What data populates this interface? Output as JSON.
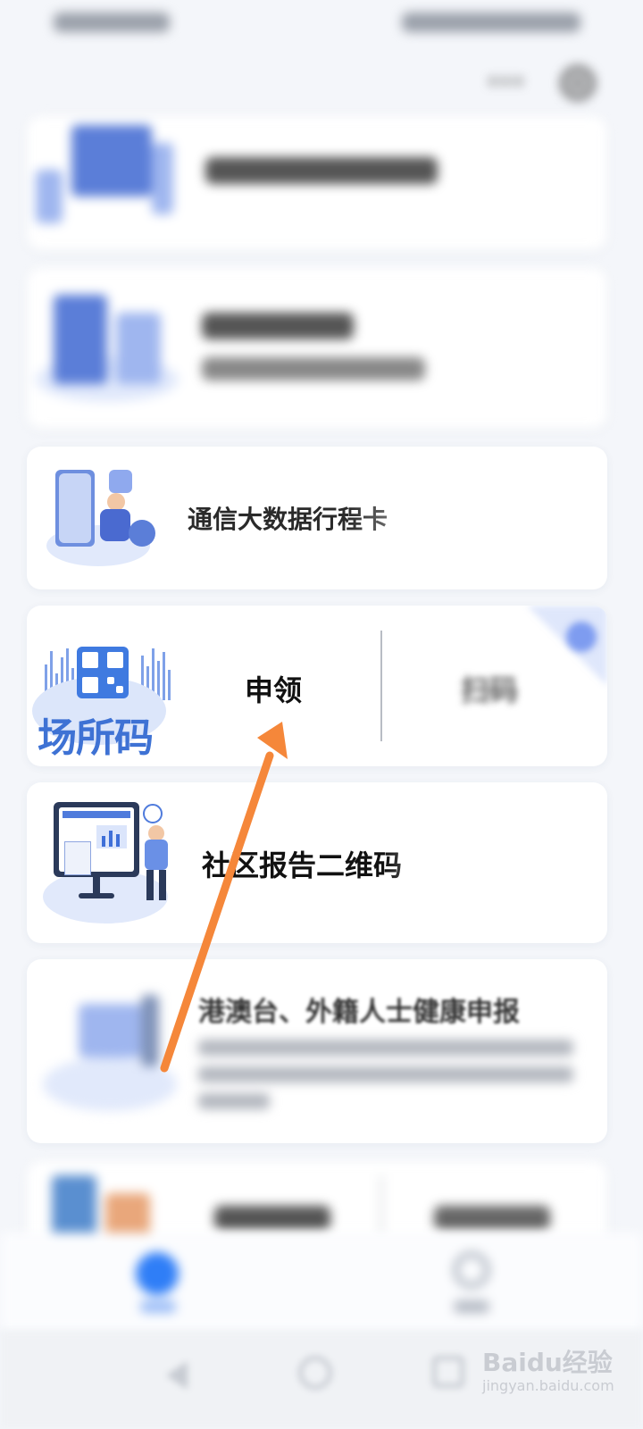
{
  "cards": {
    "trip": {
      "label": "通信大数据行程卡"
    },
    "venue": {
      "logo_text": "场所码",
      "apply_label": "申领",
      "scan_label": "扫码"
    },
    "community": {
      "label": "社区报告二维码"
    },
    "hmt": {
      "label": "港澳台、外籍人士健康申报"
    }
  },
  "colors": {
    "accent": "#2f7ef7",
    "arrow": "#f5873a",
    "logo_blue": "#3e72d4"
  },
  "watermark": {
    "text": "Baidu经验",
    "sub": "jingyan.baidu.com"
  }
}
